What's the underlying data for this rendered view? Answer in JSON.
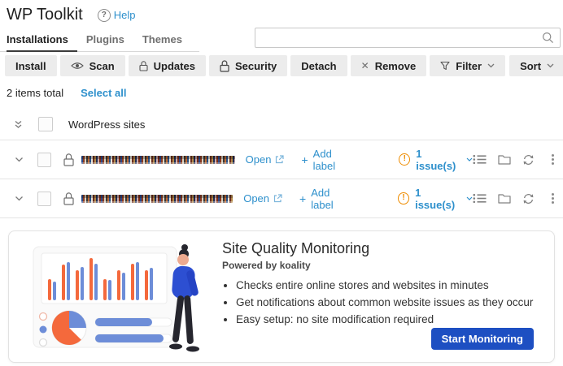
{
  "header": {
    "title": "WP Toolkit",
    "help_label": "Help"
  },
  "tabs": [
    {
      "label": "Installations",
      "active": true
    },
    {
      "label": "Plugins",
      "active": false
    },
    {
      "label": "Themes",
      "active": false
    }
  ],
  "search": {
    "value": "",
    "placeholder": ""
  },
  "toolbar": {
    "install": "Install",
    "scan": "Scan",
    "updates": "Updates",
    "security": "Security",
    "detach": "Detach",
    "remove": "Remove",
    "filter": "Filter",
    "sort": "Sort"
  },
  "summary": {
    "items_total": "2 items total",
    "select_all": "Select all"
  },
  "group": {
    "title": "WordPress sites"
  },
  "rows": [
    {
      "site_name": "[redacted]",
      "open_label": "Open",
      "add_label": "Add label",
      "issues_label": "1 issue(s)"
    },
    {
      "site_name": "[redacted]",
      "open_label": "Open",
      "add_label": "Add label",
      "issues_label": "1 issue(s)"
    }
  ],
  "promo": {
    "title": "Site Quality Monitoring",
    "subtitle": "Powered by koality",
    "bullets": [
      "Checks entire online stores and websites in minutes",
      "Get notifications about common website issues as they occur",
      "Easy setup: no site modification required"
    ],
    "cta_label": "Start Monitoring"
  },
  "icons": {
    "help": "?",
    "warning": "!",
    "plus": "+",
    "remove_x": "✕"
  },
  "colors": {
    "link_blue": "#2e90cc",
    "warning_orange": "#ee8c00",
    "cta_blue": "#1d4fc2",
    "active_tab_underline": "#3c3c3c",
    "illustration_orange": "#f4693c",
    "illustration_blue": "#6d8dd8"
  }
}
